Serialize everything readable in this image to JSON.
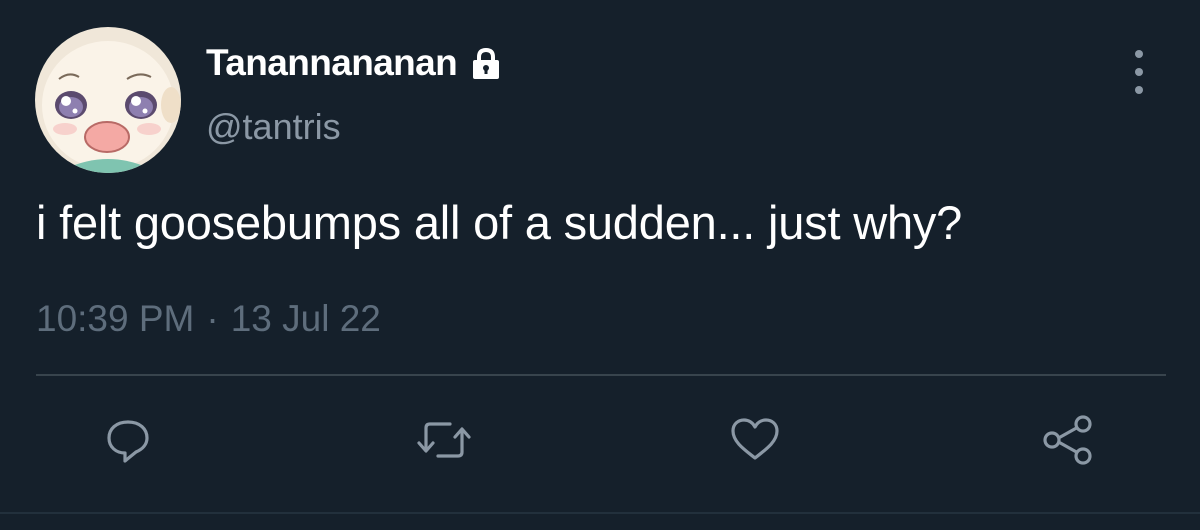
{
  "user": {
    "display_name": "Tanannananan",
    "handle": "@tantris",
    "protected_icon": "lock-icon",
    "avatar_icon": "cartoon-baby-face-avatar"
  },
  "tweet": {
    "text": "i felt goosebumps all of a sudden... just why?",
    "time": "10:39 PM",
    "separator": "·",
    "date": "13 Jul 22"
  },
  "actions": [
    {
      "icon": "reply-icon"
    },
    {
      "icon": "retweet-icon"
    },
    {
      "icon": "like-icon"
    },
    {
      "icon": "share-icon"
    }
  ],
  "menu_icon": "more-options-icon",
  "colors": {
    "background": "#15202b",
    "primary_text": "#ffffff",
    "secondary_text": "#8b98a5",
    "timestamp_text": "#5e6d7c",
    "divider": "#38444d",
    "icon": "#8b98a5"
  }
}
